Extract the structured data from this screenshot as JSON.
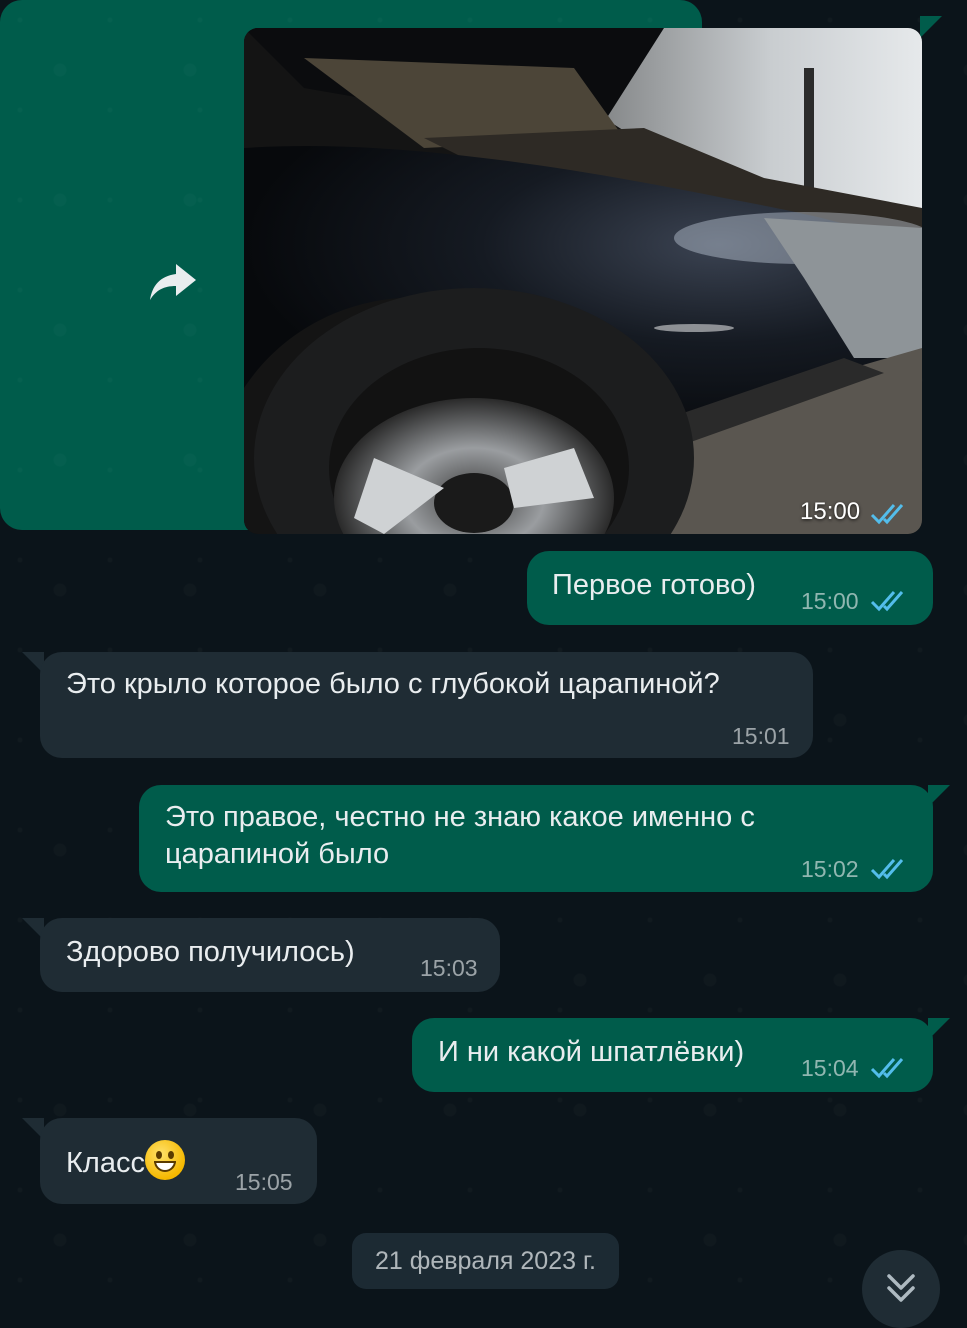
{
  "messages": {
    "photo": {
      "time": "15:00",
      "status": "read"
    },
    "m1": {
      "text": "Первое готово)",
      "time": "15:00",
      "direction": "outgoing",
      "status": "read"
    },
    "m2": {
      "text": "Это крыло которое было с глубокой царапиной?",
      "time": "15:01",
      "direction": "incoming"
    },
    "m3": {
      "line1": "Это правое, честно не знаю какое именно с",
      "line2": "царапиной было",
      "time": "15:02",
      "direction": "outgoing",
      "status": "read"
    },
    "m4": {
      "text": "Здорово получилось)",
      "time": "15:03",
      "direction": "incoming"
    },
    "m5": {
      "text": "И ни какой шпатлёвки)",
      "time": "15:04",
      "direction": "outgoing",
      "status": "read"
    },
    "m6": {
      "text": "Класс",
      "emoji": "grinning-face",
      "time": "15:05",
      "direction": "incoming"
    }
  },
  "date_separator": "21 февраля 2023 г.",
  "icons": {
    "forward": "forward-icon",
    "read_receipt": "double-check-icon",
    "scroll_down": "chevron-double-down-icon"
  },
  "colors": {
    "background": "#0b141a",
    "outgoing_bubble": "#005c4b",
    "incoming_bubble": "#1f2c34",
    "read_check": "#53bdeb"
  }
}
